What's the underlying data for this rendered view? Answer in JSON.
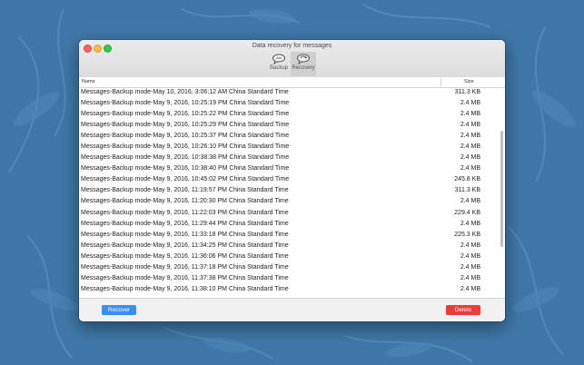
{
  "window": {
    "title": "Data recovery for messages"
  },
  "toolbar": {
    "backup_label": "Backup",
    "recovery_label": "Recovery"
  },
  "table": {
    "columns": {
      "name": "Name",
      "size": "Size"
    },
    "rows": [
      {
        "name": "Messages-Backup mode-May 10, 2016, 3:06:12 AM China Standard Time",
        "size": "311.3 KB"
      },
      {
        "name": "Messages-Backup mode-May 9, 2016, 10:25:19 PM China Standard Time",
        "size": "2.4 MB"
      },
      {
        "name": "Messages-Backup mode-May 9, 2016, 10:25:22 PM China Standard Time",
        "size": "2.4 MB"
      },
      {
        "name": "Messages-Backup mode-May 9, 2016, 10:25:29 PM China Standard Time",
        "size": "2.4 MB"
      },
      {
        "name": "Messages-Backup mode-May 9, 2016, 10:25:37 PM China Standard Time",
        "size": "2.4 MB"
      },
      {
        "name": "Messages-Backup mode-May 9, 2016, 10:26:10 PM China Standard Time",
        "size": "2.4 MB"
      },
      {
        "name": "Messages-Backup mode-May 9, 2016, 10:38:38 PM China Standard Time",
        "size": "2.4 MB"
      },
      {
        "name": "Messages-Backup mode-May 9, 2016, 10:38:40 PM China Standard Time",
        "size": "2.4 MB"
      },
      {
        "name": "Messages-Backup mode-May 9, 2016, 10:45:02 PM China Standard Time",
        "size": "245.8 KB"
      },
      {
        "name": "Messages-Backup mode-May 9, 2016, 11:19:57 PM China Standard Time",
        "size": "311.3 KB"
      },
      {
        "name": "Messages-Backup mode-May 9, 2016, 11:20:30 PM China Standard Time",
        "size": "2.4 MB"
      },
      {
        "name": "Messages-Backup mode-May 9, 2016, 11:22:03 PM China Standard Time",
        "size": "229.4 KB"
      },
      {
        "name": "Messages-Backup mode-May 9, 2016, 11:29:44 PM China Standard Time",
        "size": "2.4 MB"
      },
      {
        "name": "Messages-Backup mode-May 9, 2016, 11:33:18 PM China Standard Time",
        "size": "225.3 KB"
      },
      {
        "name": "Messages-Backup mode-May 9, 2016, 11:34:25 PM China Standard Time",
        "size": "2.4 MB"
      },
      {
        "name": "Messages-Backup mode-May 9, 2016, 11:36:06 PM China Standard Time",
        "size": "2.4 MB"
      },
      {
        "name": "Messages-Backup mode-May 9, 2016, 11:37:18 PM China Standard Time",
        "size": "2.4 MB"
      },
      {
        "name": "Messages-Backup mode-May 9, 2016, 11:37:38 PM China Standard Time",
        "size": "2.4 MB"
      },
      {
        "name": "Messages-Backup mode-May 9, 2016, 11:38:10 PM China Standard Time",
        "size": "2.4 MB"
      }
    ]
  },
  "footer": {
    "recover_label": "Recover",
    "delete_label": "Delete"
  },
  "colors": {
    "accent_blue": "#3a8ef1",
    "danger_red": "#ee3b36",
    "desktop_bg": "#3f78a8"
  },
  "icons": {
    "backup": "chat-bubble-backup-icon",
    "recovery": "chat-bubble-recovery-icon"
  }
}
